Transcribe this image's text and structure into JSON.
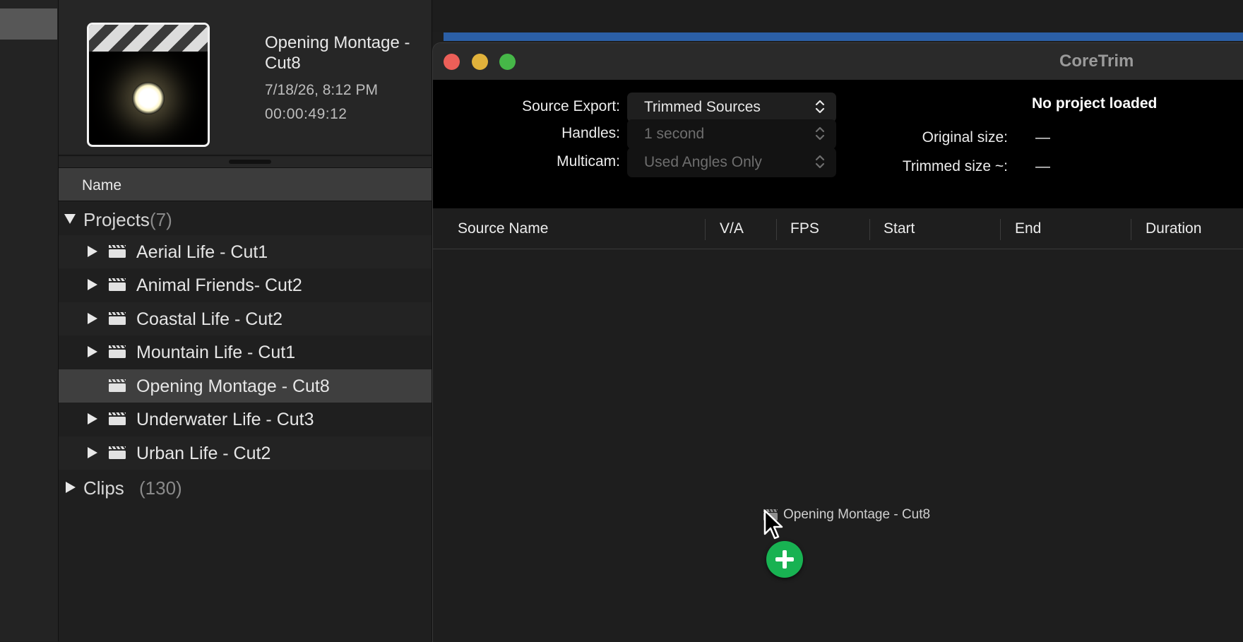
{
  "browser": {
    "preview": {
      "title": "Opening Montage - Cut8",
      "date": "7/18/26, 8:12 PM",
      "duration": "00:00:49:12"
    },
    "column_header": "Name",
    "projects": {
      "label": "Projects",
      "count": "(7)"
    },
    "items": [
      {
        "label": "Aerial Life - Cut1"
      },
      {
        "label": "Animal Friends- Cut2"
      },
      {
        "label": "Coastal Life - Cut2"
      },
      {
        "label": "Mountain Life - Cut1"
      },
      {
        "label": "Opening Montage - Cut8"
      },
      {
        "label": "Underwater Life - Cut3"
      },
      {
        "label": "Urban Life - Cut2"
      }
    ],
    "clips": {
      "label": "Clips",
      "count": "(130)"
    }
  },
  "window": {
    "title": "CoreTrim",
    "source_export": {
      "label": "Source Export:",
      "value": "Trimmed Sources"
    },
    "handles": {
      "label": "Handles:",
      "value": "1 second"
    },
    "multicam": {
      "label": "Multicam:",
      "value": "Used Angles Only"
    },
    "status": "No project loaded",
    "original_size": {
      "label": "Original size:",
      "value": "—"
    },
    "trimmed_size": {
      "label": "Trimmed size ~:",
      "value": "—"
    },
    "columns": [
      "Source Name",
      "V/A",
      "FPS",
      "Start",
      "End",
      "Duration"
    ]
  },
  "drag": {
    "label": "Opening Montage - Cut8"
  },
  "colors": {
    "accent_blue": "#2b5fa6",
    "add_green": "#18b252"
  },
  "icons": [
    "clapperboard-icon",
    "disclosure-triangle-icon",
    "popup-arrows-icon",
    "cursor-icon",
    "add-icon"
  ]
}
